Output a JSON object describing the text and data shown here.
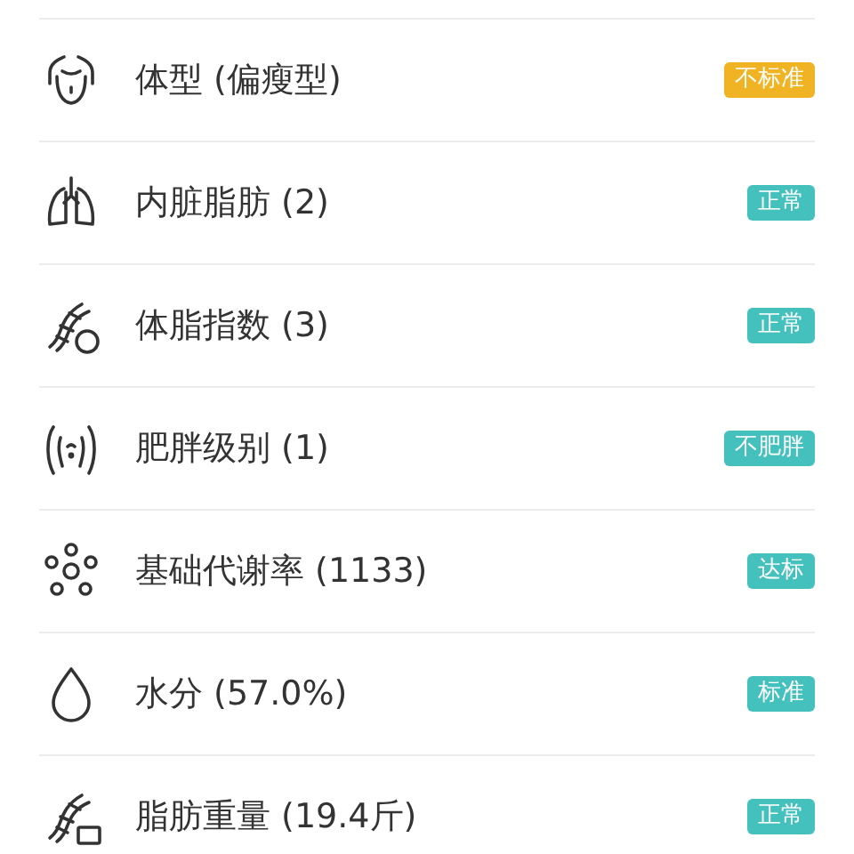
{
  "metrics": [
    {
      "label": "体型 (偏瘦型)",
      "badge": "不标准",
      "color": "#f0b323"
    },
    {
      "label": "内脏脂肪 (2)",
      "badge": "正常",
      "color": "#45c1bd"
    },
    {
      "label": "体脂指数 (3)",
      "badge": "正常",
      "color": "#45c1bd"
    },
    {
      "label": "肥胖级别 (1)",
      "badge": "不肥胖",
      "color": "#45c1bd"
    },
    {
      "label": "基础代谢率 (1133)",
      "badge": "达标",
      "color": "#45c1bd"
    },
    {
      "label": "水分 (57.0%)",
      "badge": "标准",
      "color": "#45c1bd"
    },
    {
      "label": "脂肪重量 (19.4斤)",
      "badge": "正常",
      "color": "#45c1bd"
    }
  ]
}
